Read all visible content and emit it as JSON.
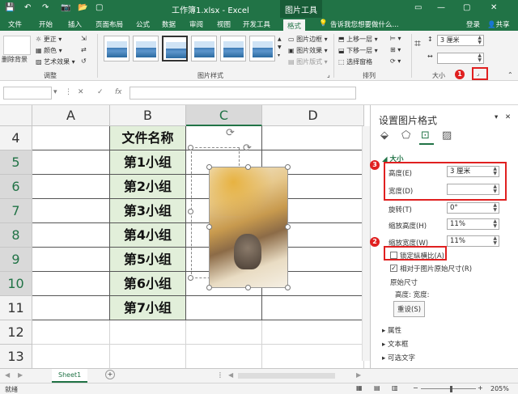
{
  "titlebar": {
    "title": "工作簿1.xlsx - Excel",
    "context": "图片工具",
    "login": "登录"
  },
  "tabs": [
    "文件",
    "开始",
    "插入",
    "页面布局",
    "公式",
    "数据",
    "审阅",
    "视图",
    "开发工具",
    "格式"
  ],
  "tellme": "告诉我您想要做什么...",
  "share": "共享",
  "ribbon": {
    "remove_bg": "删除背景",
    "adjust": {
      "label": "调整",
      "items": [
        "更正",
        "颜色",
        "艺术效果"
      ]
    },
    "styles_label": "图片样式",
    "style_items": [
      "图片边框",
      "图片效果",
      "图片版式"
    ],
    "arrange": {
      "label": "排列",
      "items": [
        "上移一层",
        "下移一层",
        "选择窗格"
      ]
    },
    "size": {
      "label": "大小",
      "height": "3 厘米",
      "width": ""
    }
  },
  "namebox": "",
  "fx": "fx",
  "columns": [
    "A",
    "B",
    "C",
    "D"
  ],
  "rows": [
    "4",
    "5",
    "6",
    "7",
    "8",
    "9",
    "10",
    "11",
    "12",
    "13"
  ],
  "cells": [
    "文件名称",
    "第1小组",
    "第2小组",
    "第3小组",
    "第4小组",
    "第5小组",
    "第6小组",
    "第7小组"
  ],
  "sheet": {
    "tab": "Sheet1",
    "add": "+"
  },
  "status": {
    "left": "就绪",
    "zoom": "205%"
  },
  "pane": {
    "title": "设置图片格式",
    "section": "大小",
    "height_label": "高度(E)",
    "height_value": "3 厘米",
    "width_label": "宽度(D)",
    "width_value": "",
    "rotate_label": "旋转(T)",
    "rotate_value": "0°",
    "scale_h_label": "缩放高度(H)",
    "scale_h_value": "11%",
    "scale_w_label": "缩放宽度(W)",
    "scale_w_value": "11%",
    "lock_label": "锁定纵横比(A)",
    "relative_label": "相对于图片原始尺寸(R)",
    "orig_label": "原始尺寸",
    "orig_hw": "高度:  宽度:",
    "reset": "重设(S)",
    "props": "属性",
    "textbox": "文本框",
    "alt": "可选文字"
  },
  "badges": [
    "1",
    "2",
    "3"
  ]
}
